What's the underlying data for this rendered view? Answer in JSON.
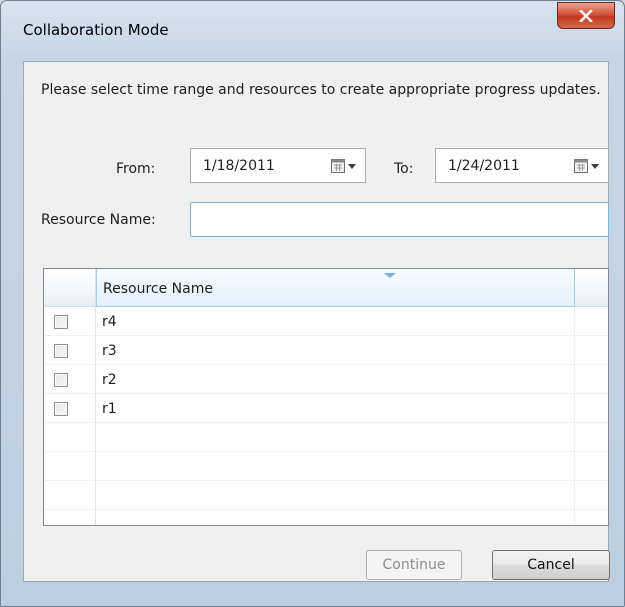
{
  "dialog": {
    "title": "Collaboration Mode",
    "instruction": "Please select time range and resources to create appropriate progress updates."
  },
  "range": {
    "from_label": "From:",
    "from_value": "1/18/2011",
    "to_label": "To:",
    "to_value": "1/24/2011"
  },
  "resource_filter": {
    "label": "Resource Name:",
    "value": ""
  },
  "grid": {
    "column_header": "Resource Name",
    "rows": [
      {
        "name": "r4",
        "checked": false
      },
      {
        "name": "r3",
        "checked": false
      },
      {
        "name": "r2",
        "checked": false
      },
      {
        "name": "r1",
        "checked": false
      }
    ]
  },
  "buttons": {
    "continue_label": "Continue",
    "continue_enabled": false,
    "cancel_label": "Cancel"
  },
  "icons": {
    "close": "close-icon",
    "calendar": "calendar-dropdown-icon"
  },
  "colors": {
    "close_button": "#c94a2f",
    "focus_border": "#7fb1db",
    "disabled_text": "#8d8d8d"
  }
}
